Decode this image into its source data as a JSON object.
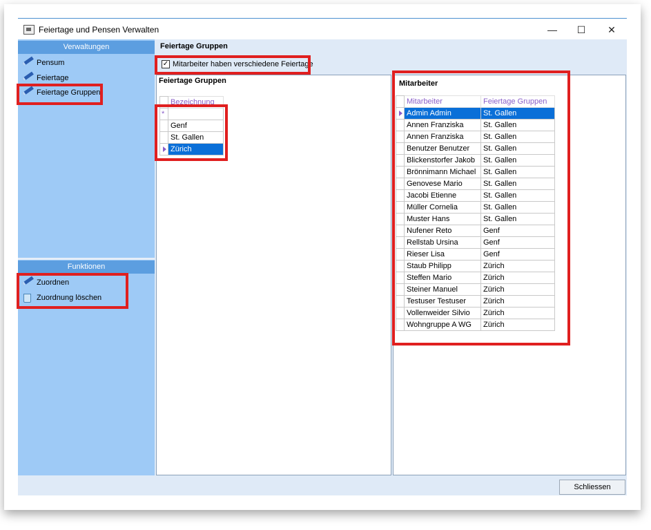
{
  "window": {
    "title": "Feiertage und Pensen Verwalten",
    "minimize": "—",
    "maximize": "☐",
    "close": "✕"
  },
  "sidebar": {
    "header": "Verwaltungen",
    "items": [
      {
        "label": "Pensum",
        "icon": "pencil-icon"
      },
      {
        "label": "Feiertage",
        "icon": "pencil-icon"
      },
      {
        "label": "Feiertage Gruppen",
        "icon": "pencil-icon"
      }
    ],
    "functions_header": "Funktionen",
    "functions": [
      {
        "label": "Zuordnen",
        "icon": "pencil-icon"
      },
      {
        "label": "Zuordnung löschen",
        "icon": "trash-icon"
      }
    ]
  },
  "main": {
    "heading": "Feiertage Gruppen",
    "checkbox_label": "Mitarbeiter haben verschiedene Feiertage",
    "checkbox_checked": true
  },
  "groups_panel": {
    "title": "Feiertage Gruppen",
    "column": "Bezeichnung",
    "new_row_marker": "*",
    "rows": [
      "Genf",
      "St. Gallen",
      "Zürich"
    ],
    "selected": "Zürich"
  },
  "employees_panel": {
    "title": "Mitarbeiter",
    "columns": [
      "Mitarbeiter",
      "Feiertage Gruppen"
    ],
    "rows": [
      [
        "Admin Admin",
        "St. Gallen"
      ],
      [
        "Annen Franziska",
        "St. Gallen"
      ],
      [
        "Annen Franziska",
        "St. Gallen"
      ],
      [
        "Benutzer Benutzer",
        "St. Gallen"
      ],
      [
        "Blickenstorfer Jakob",
        "St. Gallen"
      ],
      [
        "Brönnimann Michael",
        "St. Gallen"
      ],
      [
        "Genovese Mario",
        "St. Gallen"
      ],
      [
        "Jacobi Etienne",
        "St. Gallen"
      ],
      [
        "Müller Cornelia",
        "St. Gallen"
      ],
      [
        "Muster Hans",
        "St. Gallen"
      ],
      [
        "Nufener Reto",
        "Genf"
      ],
      [
        "Rellstab Ursina",
        "Genf"
      ],
      [
        "Rieser Lisa",
        "Genf"
      ],
      [
        "Staub Philipp",
        "Zürich"
      ],
      [
        "Steffen Mario",
        "Zürich"
      ],
      [
        "Steiner Manuel",
        "Zürich"
      ],
      [
        "Testuser Testuser",
        "Zürich"
      ],
      [
        "Vollenweider Silvio",
        "Zürich"
      ],
      [
        "Wohngruppe A WG",
        "Zürich"
      ]
    ],
    "selected_index": 0
  },
  "footer": {
    "close_label": "Schliessen"
  },
  "colors": {
    "highlight": "#e01f1f",
    "selection": "#0a6fd8",
    "sidebar": "#9ecaf6",
    "sidebar_header": "#5c9ee0"
  }
}
